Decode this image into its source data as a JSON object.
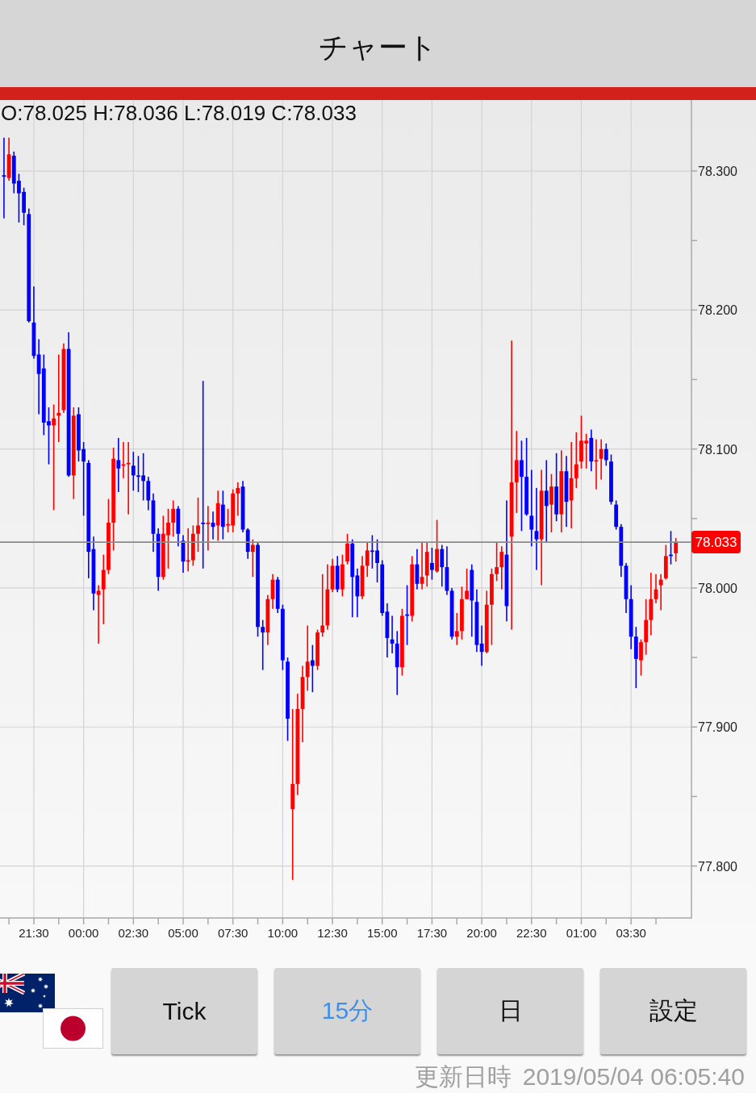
{
  "header": {
    "title": "チャート"
  },
  "chart": {
    "ohlc_readout": "O:78.025 H:78.036 L:78.019 C:78.033",
    "chart_data": {
      "type": "candlestick",
      "x": [
        "2019-05-02 20:00",
        "2019-05-02 20:15",
        "2019-05-02 20:30",
        "2019-05-02 20:45",
        "2019-05-02 21:00",
        "2019-05-02 21:15",
        "2019-05-02 21:30",
        "2019-05-02 21:45",
        "2019-05-02 22:00",
        "2019-05-02 22:15",
        "2019-05-02 22:30",
        "2019-05-02 22:45",
        "2019-05-02 23:00",
        "2019-05-02 23:15",
        "2019-05-02 23:30",
        "2019-05-02 23:45",
        "2019-05-03 00:00",
        "2019-05-03 00:15",
        "2019-05-03 00:30",
        "2019-05-03 00:45",
        "2019-05-03 01:00",
        "2019-05-03 01:15",
        "2019-05-03 01:30",
        "2019-05-03 01:45",
        "2019-05-03 02:00",
        "2019-05-03 02:15",
        "2019-05-03 02:30",
        "2019-05-03 02:45",
        "2019-05-03 03:00",
        "2019-05-03 03:15",
        "2019-05-03 03:30",
        "2019-05-03 03:45",
        "2019-05-03 04:00",
        "2019-05-03 04:15",
        "2019-05-03 04:30",
        "2019-05-03 04:45",
        "2019-05-03 05:00",
        "2019-05-03 05:15",
        "2019-05-03 05:30",
        "2019-05-03 05:45",
        "2019-05-03 06:00",
        "2019-05-03 06:15",
        "2019-05-03 06:30",
        "2019-05-03 06:45",
        "2019-05-03 07:00",
        "2019-05-03 07:15",
        "2019-05-03 07:30",
        "2019-05-03 07:45",
        "2019-05-03 08:00",
        "2019-05-03 08:15",
        "2019-05-03 08:30",
        "2019-05-03 08:45",
        "2019-05-03 09:00",
        "2019-05-03 09:15",
        "2019-05-03 09:30",
        "2019-05-03 09:45",
        "2019-05-03 10:00",
        "2019-05-03 10:15",
        "2019-05-03 10:30",
        "2019-05-03 10:45",
        "2019-05-03 11:00",
        "2019-05-03 11:15",
        "2019-05-03 11:30",
        "2019-05-03 11:45",
        "2019-05-03 12:00",
        "2019-05-03 12:15",
        "2019-05-03 12:30",
        "2019-05-03 12:45",
        "2019-05-03 13:00",
        "2019-05-03 13:15",
        "2019-05-03 13:30",
        "2019-05-03 13:45",
        "2019-05-03 14:00",
        "2019-05-03 14:15",
        "2019-05-03 14:30",
        "2019-05-03 14:45",
        "2019-05-03 15:00",
        "2019-05-03 15:15",
        "2019-05-03 15:30",
        "2019-05-03 15:45",
        "2019-05-03 16:00",
        "2019-05-03 16:15",
        "2019-05-03 16:30",
        "2019-05-03 16:45",
        "2019-05-03 17:00",
        "2019-05-03 17:15",
        "2019-05-03 17:30",
        "2019-05-03 17:45",
        "2019-05-03 18:00",
        "2019-05-03 18:15",
        "2019-05-03 18:30",
        "2019-05-03 18:45",
        "2019-05-03 19:00",
        "2019-05-03 19:15",
        "2019-05-03 19:30",
        "2019-05-03 19:45",
        "2019-05-03 20:00",
        "2019-05-03 20:15",
        "2019-05-03 20:30",
        "2019-05-03 20:45",
        "2019-05-03 21:00",
        "2019-05-03 21:15",
        "2019-05-03 21:30",
        "2019-05-03 21:45",
        "2019-05-03 22:00",
        "2019-05-03 22:15",
        "2019-05-03 22:30",
        "2019-05-03 22:45",
        "2019-05-03 23:00",
        "2019-05-03 23:15",
        "2019-05-03 23:30",
        "2019-05-03 23:45",
        "2019-05-04 00:00",
        "2019-05-04 00:15",
        "2019-05-04 00:30",
        "2019-05-04 00:45",
        "2019-05-04 01:00",
        "2019-05-04 01:15",
        "2019-05-04 01:30",
        "2019-05-04 01:45",
        "2019-05-04 02:00",
        "2019-05-04 02:15",
        "2019-05-04 02:30",
        "2019-05-04 02:45",
        "2019-05-04 03:00",
        "2019-05-04 03:15",
        "2019-05-04 03:30",
        "2019-05-04 03:45",
        "2019-05-04 04:00",
        "2019-05-04 04:15",
        "2019-05-04 04:30",
        "2019-05-04 04:45",
        "2019-05-04 05:00",
        "2019-05-04 05:15",
        "2019-05-04 05:30",
        "2019-05-04 05:45"
      ],
      "ohlc": [
        [
          78.297,
          78.324,
          78.266,
          78.296
        ],
        [
          78.295,
          78.324,
          78.293,
          78.312
        ],
        [
          78.311,
          78.314,
          78.284,
          78.291
        ],
        [
          78.293,
          78.298,
          78.263,
          78.284
        ],
        [
          78.285,
          78.288,
          78.261,
          78.27
        ],
        [
          78.269,
          78.273,
          78.191,
          78.192
        ],
        [
          78.191,
          78.217,
          78.165,
          78.167
        ],
        [
          78.168,
          78.179,
          78.125,
          78.154
        ],
        [
          78.158,
          78.168,
          78.11,
          78.119
        ],
        [
          78.12,
          78.13,
          78.089,
          78.117
        ],
        [
          78.117,
          78.132,
          78.056,
          78.122
        ],
        [
          78.124,
          78.168,
          78.105,
          78.126
        ],
        [
          78.128,
          78.176,
          78.126,
          78.172
        ],
        [
          78.172,
          78.184,
          78.08,
          78.081
        ],
        [
          78.081,
          78.13,
          78.064,
          78.124
        ],
        [
          78.125,
          78.13,
          78.091,
          78.099
        ],
        [
          78.1,
          78.105,
          78.052,
          78.091
        ],
        [
          78.09,
          78.092,
          78.007,
          78.026
        ],
        [
          78.028,
          78.037,
          77.984,
          77.996
        ],
        [
          77.995,
          78.002,
          77.96,
          77.998
        ],
        [
          77.999,
          78.024,
          77.974,
          78.013
        ],
        [
          78.013,
          78.064,
          78.01,
          78.047
        ],
        [
          78.047,
          78.101,
          78.027,
          78.093
        ],
        [
          78.092,
          78.108,
          78.069,
          78.086
        ],
        [
          78.088,
          78.105,
          78.079,
          78.089
        ],
        [
          78.089,
          78.105,
          78.053,
          78.09
        ],
        [
          78.088,
          78.098,
          78.07,
          78.081
        ],
        [
          78.081,
          78.095,
          78.069,
          78.08
        ],
        [
          78.081,
          78.097,
          78.063,
          78.077
        ],
        [
          78.077,
          78.08,
          78.056,
          78.063
        ],
        [
          78.063,
          78.068,
          78.026,
          78.039
        ],
        [
          78.039,
          78.043,
          77.998,
          78.008
        ],
        [
          78.008,
          78.052,
          78.006,
          78.039
        ],
        [
          78.038,
          78.057,
          78.014,
          78.047
        ],
        [
          78.047,
          78.063,
          78.037,
          78.057
        ],
        [
          78.057,
          78.059,
          78.03,
          78.039
        ],
        [
          78.034,
          78.038,
          78.011,
          78.019
        ],
        [
          78.019,
          78.043,
          78.012,
          78.02
        ],
        [
          78.02,
          78.045,
          78.016,
          78.039
        ],
        [
          78.039,
          78.065,
          78.026,
          78.045
        ],
        [
          78.047,
          78.149,
          78.014,
          78.046
        ],
        [
          78.046,
          78.059,
          78.027,
          78.047
        ],
        [
          78.047,
          78.055,
          78.035,
          78.044
        ],
        [
          78.045,
          78.07,
          78.034,
          78.061
        ],
        [
          78.06,
          78.07,
          78.035,
          78.044
        ],
        [
          78.045,
          78.057,
          78.04,
          78.046
        ],
        [
          78.045,
          78.071,
          78.04,
          78.068
        ],
        [
          78.068,
          78.076,
          78.052,
          78.072
        ],
        [
          78.073,
          78.077,
          78.04,
          78.042
        ],
        [
          78.042,
          78.043,
          78.021,
          78.026
        ],
        [
          78.026,
          78.035,
          78.008,
          78.031
        ],
        [
          78.031,
          78.033,
          77.965,
          77.972
        ],
        [
          77.972,
          77.977,
          77.941,
          77.968
        ],
        [
          77.968,
          77.995,
          77.959,
          77.992
        ],
        [
          77.992,
          78.01,
          77.985,
          78.006
        ],
        [
          78.006,
          78.008,
          77.982,
          77.985
        ],
        [
          77.985,
          77.988,
          77.941,
          77.948
        ],
        [
          77.947,
          77.95,
          77.89,
          77.906
        ],
        [
          77.841,
          77.913,
          77.79,
          77.859
        ],
        [
          77.859,
          77.924,
          77.851,
          77.913
        ],
        [
          77.913,
          77.944,
          77.889,
          77.936
        ],
        [
          77.936,
          77.973,
          77.926,
          77.947
        ],
        [
          77.948,
          77.959,
          77.925,
          77.944
        ],
        [
          77.944,
          77.97,
          77.941,
          77.968
        ],
        [
          77.968,
          78.01,
          77.965,
          77.973
        ],
        [
          77.973,
          78.017,
          77.97,
          77.999
        ],
        [
          77.999,
          78.021,
          77.997,
          78.016
        ],
        [
          78.016,
          78.023,
          77.997,
          77.999
        ],
        [
          77.999,
          78.024,
          77.994,
          78.017
        ],
        [
          78.019,
          78.039,
          78.017,
          78.032
        ],
        [
          78.032,
          78.035,
          77.979,
          78.008
        ],
        [
          78.009,
          78.014,
          77.979,
          77.994
        ],
        [
          77.994,
          78.023,
          77.992,
          78.016
        ],
        [
          78.016,
          78.033,
          78.008,
          78.027
        ],
        [
          78.027,
          78.038,
          78.014,
          78.026
        ],
        [
          78.027,
          78.035,
          78.004,
          78.018
        ],
        [
          78.017,
          78.02,
          77.98,
          77.982
        ],
        [
          77.983,
          77.989,
          77.95,
          77.964
        ],
        [
          77.963,
          77.98,
          77.953,
          77.96
        ],
        [
          77.96,
          77.969,
          77.923,
          77.943
        ],
        [
          77.943,
          77.985,
          77.937,
          77.98
        ],
        [
          77.981,
          78.002,
          77.959,
          77.98
        ],
        [
          77.98,
          78.023,
          77.976,
          78.017
        ],
        [
          78.017,
          78.028,
          77.999,
          78.003
        ],
        [
          78.003,
          78.033,
          77.999,
          78.008
        ],
        [
          78.009,
          78.033,
          78.001,
          78.026
        ],
        [
          78.018,
          78.029,
          78.006,
          78.013
        ],
        [
          78.012,
          78.049,
          78.011,
          78.028
        ],
        [
          78.028,
          78.031,
          78.001,
          78.015
        ],
        [
          78.015,
          78.03,
          77.995,
          77.998
        ],
        [
          77.998,
          78.0,
          77.963,
          77.965
        ],
        [
          77.965,
          77.982,
          77.959,
          77.969
        ],
        [
          77.969,
          78.001,
          77.963,
          77.992
        ],
        [
          77.992,
          78.014,
          77.992,
          77.998
        ],
        [
          78.013,
          78.017,
          77.965,
          77.991
        ],
        [
          77.99,
          77.999,
          77.954,
          77.959
        ],
        [
          77.96,
          77.973,
          77.944,
          77.954
        ],
        [
          77.954,
          77.998,
          77.953,
          77.988
        ],
        [
          77.988,
          78.014,
          77.959,
          78.01
        ],
        [
          78.01,
          78.033,
          78.005,
          78.015
        ],
        [
          78.015,
          78.03,
          77.999,
          78.026
        ],
        [
          78.024,
          78.063,
          77.976,
          77.987
        ],
        [
          78.037,
          78.178,
          77.97,
          78.076
        ],
        [
          78.076,
          78.113,
          78.054,
          78.092
        ],
        [
          78.092,
          78.106,
          78.041,
          78.08
        ],
        [
          78.08,
          78.108,
          78.052,
          78.053
        ],
        [
          78.052,
          78.085,
          78.03,
          78.042
        ],
        [
          78.041,
          78.072,
          78.013,
          78.035
        ],
        [
          78.035,
          78.085,
          78.002,
          78.07
        ],
        [
          78.07,
          78.092,
          78.033,
          78.059
        ],
        [
          78.06,
          78.082,
          78.04,
          78.073
        ],
        [
          78.073,
          78.097,
          78.048,
          78.053
        ],
        [
          78.053,
          78.099,
          78.04,
          78.084
        ],
        [
          78.084,
          78.095,
          78.044,
          78.062
        ],
        [
          78.063,
          78.105,
          78.043,
          78.079
        ],
        [
          78.079,
          78.112,
          78.072,
          78.089
        ],
        [
          78.091,
          78.124,
          78.086,
          78.106
        ],
        [
          78.104,
          78.111,
          78.086,
          78.106
        ],
        [
          78.108,
          78.114,
          78.084,
          78.091
        ],
        [
          78.091,
          78.107,
          78.071,
          78.092
        ],
        [
          78.093,
          78.107,
          78.078,
          78.1
        ],
        [
          78.1,
          78.104,
          78.088,
          78.092
        ],
        [
          78.091,
          78.096,
          78.06,
          78.062
        ],
        [
          78.06,
          78.063,
          78.042,
          78.044
        ],
        [
          78.044,
          78.046,
          78.008,
          78.016
        ],
        [
          78.016,
          78.018,
          77.982,
          77.992
        ],
        [
          77.992,
          78.002,
          77.956,
          77.965
        ],
        [
          77.965,
          77.972,
          77.928,
          77.949
        ],
        [
          77.948,
          77.963,
          77.937,
          77.961
        ],
        [
          77.961,
          77.992,
          77.952,
          77.977
        ],
        [
          77.977,
          78.011,
          77.966,
          77.992
        ],
        [
          77.992,
          78.01,
          77.989,
          77.999
        ],
        [
          78.002,
          78.01,
          77.984,
          78.006
        ],
        [
          78.007,
          78.031,
          78.006,
          78.023
        ],
        [
          78.024,
          78.041,
          78.017,
          78.023
        ],
        [
          78.025,
          78.036,
          78.019,
          78.033
        ]
      ],
      "xlim": [
        "2019-05-02 19:48",
        "2019-05-04 06:32"
      ],
      "ylim": [
        77.7626,
        78.3511
      ],
      "xticks": [
        {
          "value": "2019-05-02 21:30",
          "label": "21:30"
        },
        {
          "value": "2019-05-03 00:00",
          "label": "00:00"
        },
        {
          "value": "2019-05-03 02:30",
          "label": "02:30"
        },
        {
          "value": "2019-05-03 05:00",
          "label": "05:00"
        },
        {
          "value": "2019-05-03 07:30",
          "label": "07:30"
        },
        {
          "value": "2019-05-03 10:00",
          "label": "10:00"
        },
        {
          "value": "2019-05-03 12:30",
          "label": "12:30"
        },
        {
          "value": "2019-05-03 15:00",
          "label": "15:00"
        },
        {
          "value": "2019-05-03 17:30",
          "label": "17:30"
        },
        {
          "value": "2019-05-03 20:00",
          "label": "20:00"
        },
        {
          "value": "2019-05-03 22:30",
          "label": "22:30"
        },
        {
          "value": "2019-05-04 01:00",
          "label": "01:00"
        },
        {
          "value": "2019-05-04 03:30",
          "label": "03:30"
        }
      ],
      "yticks": [
        {
          "value": 78.3,
          "label": "78.300"
        },
        {
          "value": 78.2,
          "label": "78.200"
        },
        {
          "value": 78.1,
          "label": "78.100"
        },
        {
          "value": 78.0,
          "label": "78.000"
        },
        {
          "value": 77.9,
          "label": "77.900"
        },
        {
          "value": 77.8,
          "label": "77.800"
        }
      ],
      "grid": true,
      "ref_lines": [
        {
          "axis": "y",
          "value": 78.033,
          "label": "78.033"
        }
      ]
    }
  },
  "interval_buttons": [
    {
      "label": "Tick",
      "selected": false
    },
    {
      "label": "15分",
      "selected": true
    },
    {
      "label": "日",
      "selected": false
    }
  ],
  "settings_button": {
    "label": "設定"
  },
  "updated": {
    "label": "更新日時",
    "value": "2019/05/04 06:05:40"
  }
}
